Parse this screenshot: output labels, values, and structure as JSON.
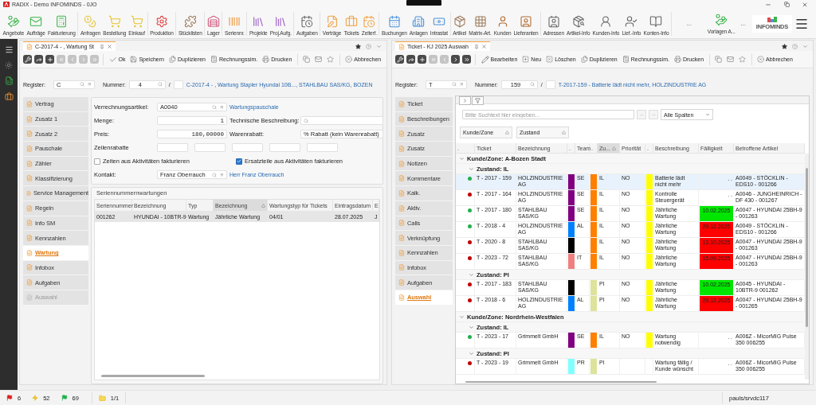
{
  "title_bar": {
    "title": "RADIX - Demo INFOMINDS - 0JO"
  },
  "ribbon": {
    "groups": [
      [
        "Angebote",
        "Aufträge",
        "Fakturierung"
      ],
      [
        "Anfragen",
        "Bestellung",
        "Einkauf"
      ],
      [
        "Produktion"
      ],
      [
        "Stücklisten"
      ],
      [
        "Lager"
      ],
      [
        "Seriennr."
      ],
      [
        "Projekte",
        "Proj.Aufg."
      ],
      [
        "Aufgaben"
      ],
      [
        "Verträge",
        "Tickets",
        "Zeiterf."
      ],
      [
        "Buchungen",
        "Anlagen",
        "Intrastat"
      ],
      [
        "Artikel",
        "Matrix-Art.",
        "Kunden",
        "Lieferanten"
      ],
      [
        "Adressen",
        "Artikel-Info",
        "Kunden-Info",
        "Lief.-Info",
        "Konten-Info"
      ]
    ],
    "more": "...",
    "templates": "Vorlagen A...",
    "more_right": "...",
    "logo_text": "INFOMINDS"
  },
  "panels": [
    {
      "kind": "contract",
      "tab": {
        "label": "C-2017-4 - , Wartung St"
      },
      "nav_buttons": [
        {
          "disabled": false
        },
        {
          "disabled": false
        },
        {
          "disabled": false
        },
        {
          "disabled": true
        },
        {
          "disabled": true
        },
        {
          "disabled": true
        },
        {
          "disabled": true
        }
      ],
      "actions": [
        {
          "kind": "ok",
          "label": "Ok"
        },
        {
          "kind": "save",
          "label": "Speichern"
        },
        {
          "kind": "duplicate",
          "label": "Duplizieren"
        },
        {
          "kind": "simulate",
          "label": "Rechnungssim."
        },
        {
          "kind": "print",
          "label": "Drucken"
        },
        {
          "kind": "copy"
        },
        {
          "kind": "mail"
        },
        {
          "kind": "favorite"
        },
        {
          "kind": "cancel",
          "label": "Abbrechen"
        }
      ],
      "register": {
        "label": "Register:",
        "value": "C",
        "number_label": "Nummer:",
        "number": "4",
        "separator": "/",
        "summary": "C-2017-4 - , Wartung Stapler Hyundai 10B..., STAHLBAU SAS/KG, BOZEN"
      },
      "nav": [
        {
          "label": "Vertrag",
          "selected": false,
          "disabled": false
        },
        {
          "label": "Zusatz 1",
          "selected": false,
          "disabled": false
        },
        {
          "label": "Zusatz 2",
          "selected": false,
          "disabled": false
        },
        {
          "label": "Pauschale",
          "selected": false,
          "disabled": false
        },
        {
          "label": "Zähler",
          "selected": false,
          "disabled": false
        },
        {
          "label": "Klassifizierung",
          "selected": false,
          "disabled": false
        },
        {
          "label": "Service Management",
          "selected": false,
          "disabled": false
        },
        {
          "label": "Regeln",
          "selected": false,
          "disabled": false
        },
        {
          "label": "Info SM",
          "selected": false,
          "disabled": false
        },
        {
          "label": "Kennzahlen",
          "selected": false,
          "disabled": false
        },
        {
          "label": "Wartung",
          "selected": true,
          "disabled": false
        },
        {
          "label": "Infobox",
          "selected": false,
          "disabled": false
        },
        {
          "label": "Aufgaben",
          "selected": false,
          "disabled": false
        },
        {
          "label": "Auswahl",
          "selected": false,
          "disabled": true
        }
      ],
      "form": {
        "article": {
          "label": "Verrechnungsartikel:",
          "value": "A0040",
          "link": "Wartungspauschale"
        },
        "quantity": {
          "label": "Menge:",
          "value": "1"
        },
        "tech_description": {
          "label": "Technische Beschreibung:"
        },
        "price": {
          "label": "Preis:",
          "value": "180,00000"
        },
        "discount": {
          "label": "Warenrabatt:",
          "value": "% Rabatt (kein Warenrabatt)"
        },
        "line_discounts": {
          "label": "Zeilenrabatte"
        },
        "checkboxes": [
          {
            "label": "Zeiten aus Aktivitäten fakturieren",
            "checked": false
          },
          {
            "label": "Ersatzteile aus Aktivitäten fakturieren",
            "checked": true
          }
        ],
        "contact": {
          "label": "Kontakt:",
          "value": "Franz Oberrauch",
          "link": "Herr Franz Oberrauch"
        }
      },
      "maintenance": {
        "title": "Seriennummernwartungen",
        "columns": [
          {
            "label": "Seriennummer",
            "sorted": false
          },
          {
            "label": "Bezeichnung",
            "sorted": false
          },
          {
            "label": "Typ",
            "sorted": false
          },
          {
            "label": "Bezeichnung",
            "sorted": true
          },
          {
            "label": "Wartungstyp für Tickets",
            "sorted": false
          },
          {
            "label": "Eintragsdatum",
            "sorted": false
          },
          {
            "label": "E",
            "sorted": false
          }
        ],
        "rows": [
          {
            "selected": true,
            "cells": [
              "001262",
              "HYUNDAI - 10BTR-9",
              "Wartung",
              "Jährliche Wartung",
              "04/01",
              "28.07.2025",
              "J"
            ]
          }
        ]
      }
    },
    {
      "kind": "tickets",
      "tab": {
        "label": "Ticket - KJ 2025 Auswah"
      },
      "nav_buttons": [
        {
          "disabled": false
        },
        {
          "disabled": false
        },
        {
          "disabled": false
        },
        {
          "disabled": true
        },
        {
          "disabled": true
        },
        {
          "disabled": false
        },
        {
          "disabled": false
        }
      ],
      "actions": [
        {
          "kind": "edit",
          "label": "Bearbeiten"
        },
        {
          "kind": "new",
          "label": "Neu"
        },
        {
          "kind": "delete",
          "label": "Löschen"
        },
        {
          "kind": "duplicate",
          "label": "Duplizieren"
        },
        {
          "kind": "simulate",
          "label": "Rechnungssim."
        },
        {
          "kind": "print",
          "label": "Drucken"
        },
        {
          "kind": "copy"
        },
        {
          "kind": "mail"
        },
        {
          "kind": "favorite"
        },
        {
          "kind": "cancel",
          "label": "Abbrechen"
        }
      ],
      "register": {
        "label": "Register:",
        "value": "T",
        "number_label": "Nummer:",
        "number": "159",
        "separator": "/",
        "summary": "T-2017-159 - Batterie lädt nicht mehr, HOLZINDUSTRIE AG"
      },
      "nav": [
        {
          "label": "Ticket",
          "selected": false,
          "disabled": false
        },
        {
          "label": "Beschreibungen",
          "selected": false,
          "disabled": false
        },
        {
          "label": "Zusatz",
          "selected": false,
          "disabled": false
        },
        {
          "label": "Zusatz",
          "selected": false,
          "disabled": false
        },
        {
          "label": "Notizen",
          "selected": false,
          "disabled": false
        },
        {
          "label": "Kommentare",
          "selected": false,
          "disabled": false
        },
        {
          "label": "Kalk.",
          "selected": false,
          "disabled": false
        },
        {
          "label": "Aktiv.",
          "selected": false,
          "disabled": false
        },
        {
          "label": "Calls",
          "selected": false,
          "disabled": false
        },
        {
          "label": "Verknüpfung",
          "selected": false,
          "disabled": false
        },
        {
          "label": "Kennzahlen",
          "selected": false,
          "disabled": false
        },
        {
          "label": "Infobox",
          "selected": false,
          "disabled": false
        },
        {
          "label": "Aufgaben",
          "selected": false,
          "disabled": false
        },
        {
          "label": "Auswahl",
          "selected": true,
          "disabled": false
        }
      ],
      "grid": {
        "search": {
          "placeholder": "Bitte Suchtext hier eingeben..."
        },
        "column_filter": "Alle Spalten",
        "group_by": [
          {
            "label": "Kunde/Zone"
          },
          {
            "label": "Zustand"
          }
        ],
        "columns": [
          {
            "label": ".",
            "sorted": false
          },
          {
            "label": "Ticket",
            "sorted": false
          },
          {
            "label": "Bezeichnung",
            "sorted": false
          },
          {
            "label": ".",
            "sorted": false
          },
          {
            "label": "Team",
            "sorted": false
          },
          {
            "label": ".",
            "sorted": false
          },
          {
            "label": "Zu...",
            "sorted": true
          },
          {
            "label": "Priorität",
            "sorted": false
          },
          {
            "label": ".",
            "sorted": false
          },
          {
            "label": "Beschreibung",
            "sorted": false
          },
          {
            "label": "Fälligkeit",
            "sorted": false
          },
          {
            "label": "Betroffene Artikel",
            "sorted": false
          }
        ],
        "groups": [
          {
            "label": "Kunde/Zone: A-Bozen Stadt",
            "expanded": true,
            "children": [
              {
                "label": "Zustand: IL",
                "expanded": true,
                "rows": [
                  {
                    "selected": true,
                    "color": "#22b14c",
                    "ticket": "T - 2017 - 159",
                    "name": "HOLZINDUSTRIE AG",
                    "team": {
                      "label": "SE",
                      "color": "#800080"
                    },
                    "state": {
                      "label": "IL",
                      "color": "#ff8000"
                    },
                    "priority": {
                      "label": "NO",
                      "color": "#ffff00"
                    },
                    "description": "Batterie lädt nicht mehr",
                    "due": {
                      "label": ". ."
                    },
                    "article": "A0049 - STÖCKLIN - EDS10 - 001266"
                  },
                  {
                    "selected": false,
                    "color": "#c00000",
                    "ticket": "T - 2017 - 164",
                    "name": "HOLZINDUSTRIE AG",
                    "team": {
                      "label": "SE",
                      "color": "#800080"
                    },
                    "state": {
                      "label": "IL",
                      "color": "#ff8000"
                    },
                    "priority": {
                      "label": "NO",
                      "color": "#ffff00"
                    },
                    "description": "Kontrolle Steuergerät",
                    "due": {
                      "label": ". ."
                    },
                    "article": "A0046 - JUNGHEINRICH - DF 430 - 001267"
                  },
                  {
                    "selected": false,
                    "color": "#22b14c",
                    "ticket": "T - 2017 - 180",
                    "name": "STAHLBAU SAS/KG",
                    "team": {
                      "label": "SE",
                      "color": "#800080"
                    },
                    "state": {
                      "label": "IL",
                      "color": "#ff8000"
                    },
                    "priority": {
                      "label": "NO",
                      "color": "#ffff00"
                    },
                    "description": "Jährliche Wartung",
                    "due": {
                      "label": "10.02.2025",
                      "color": "#00e600"
                    },
                    "article": "A0047 - HYUNDAI 25BH-9 - 001263"
                  },
                  {
                    "selected": false,
                    "color": "#22b14c",
                    "ticket": "T - 2018 - 4",
                    "name": "HOLZINDUSTRIE AG",
                    "team": {
                      "label": "AL",
                      "color": "#0080ff"
                    },
                    "state": {
                      "label": "IL",
                      "color": "#ff8000"
                    },
                    "priority": {
                      "label": "NO",
                      "color": "#ffff00"
                    },
                    "description": "Jährliche Wartung",
                    "due": {
                      "label": "29.12.2025",
                      "color": "#ff0000"
                    },
                    "article": "A0049 - STÖCKLIN - EDS10 - 001266"
                  },
                  {
                    "selected": false,
                    "color": "#c00000",
                    "ticket": "T - 2020 - 8",
                    "name": "STAHLBAU SAS/KG",
                    "team": {
                      "color": "#000000"
                    },
                    "state": {
                      "label": "IL",
                      "color": "#ff8000"
                    },
                    "priority": {
                      "label": "NO",
                      "color": "#ffff00"
                    },
                    "description": "Jährliche Wartung",
                    "due": {
                      "label": "13.10.2025",
                      "color": "#ff0000"
                    },
                    "article": "A0047 - HYUNDAI 25BH-9 - 001263"
                  },
                  {
                    "selected": false,
                    "color": "#c00000",
                    "ticket": "T - 2023 - 72",
                    "name": "STAHLBAU SAS/KG",
                    "team": {
                      "label": "IT",
                      "color": "#f08080"
                    },
                    "state": {
                      "label": "IL",
                      "color": "#ff8000"
                    },
                    "priority": {
                      "label": "NO",
                      "color": "#ffff00"
                    },
                    "description": "Jährliche Wartung",
                    "due": {
                      "label": "15.09.2025",
                      "color": "#ff0000"
                    },
                    "article": "A0047 - HYUNDAI 25BH-9 - 001263"
                  }
                ]
              },
              {
                "label": "Zustand: PI",
                "expanded": true,
                "rows": [
                  {
                    "selected": false,
                    "color": "#c00000",
                    "ticket": "T - 2017 - 183",
                    "name": "STAHLBAU SAS/KG",
                    "team": {
                      "color": "#000000"
                    },
                    "state": {
                      "label": "PI",
                      "color": "#dde39a"
                    },
                    "priority": {
                      "label": "NO",
                      "color": "#ffff00"
                    },
                    "description": "Jährliche Wartung",
                    "due": {
                      "label": "10.02.2025",
                      "color": "#00e600"
                    },
                    "article": "A0045 - HYUNDAI - 10BTR-9 001262"
                  },
                  {
                    "selected": false,
                    "color": "#c00000",
                    "ticket": "T - 2018 - 6",
                    "name": "HOLZINDUSTRIE AG",
                    "team": {
                      "label": "AL",
                      "color": "#0080ff"
                    },
                    "state": {
                      "label": "PI",
                      "color": "#dde39a"
                    },
                    "priority": {
                      "label": "NO",
                      "color": "#ffff00"
                    },
                    "description": "Jährliche Wartung",
                    "due": {
                      "label": "29.12.2025",
                      "color": "#ff0000"
                    },
                    "article": "A0047 - HYUNDAI 25BH-9 - 001265"
                  }
                ]
              }
            ]
          },
          {
            "label": "Kunde/Zone: Nordrhein-Westfalen",
            "expanded": true,
            "children": [
              {
                "label": "Zustand: IL",
                "expanded": true,
                "rows": [
                  {
                    "selected": false,
                    "color": "#22b14c",
                    "ticket": "T - 2023 - 17",
                    "name": "Grimmelt GmbH",
                    "team": {
                      "label": "SE",
                      "color": "#800080"
                    },
                    "state": {
                      "label": "IL",
                      "color": "#ff8000"
                    },
                    "priority": {
                      "label": "NO",
                      "color": "#ffff00"
                    },
                    "description": "Wartung notwendig",
                    "due": {
                      "label": ". ."
                    },
                    "article": "A006Z - MicorMIG Pulse 350 006255"
                  }
                ]
              },
              {
                "label": "Zustand: PI",
                "expanded": true,
                "rows": [
                  {
                    "selected": false,
                    "color": "#c00000",
                    "ticket": "T - 2023 - 19",
                    "name": "Grimmelt GmbH",
                    "team": {
                      "label": "PR",
                      "color": "#80ffff"
                    },
                    "state": {
                      "label": "PI",
                      "color": "#dde39a"
                    },
                    "description": "Wartung fällig / Kunde wünscht",
                    "due": {
                      "label": ". ."
                    },
                    "article": "A006Z - MicorMIG Pulse 350 006255"
                  }
                ]
              }
            ]
          }
        ]
      }
    }
  ],
  "status_bar": {
    "items": [
      {
        "kind": "error",
        "count": "6"
      },
      {
        "kind": "warning",
        "count": "52"
      },
      {
        "kind": "ok",
        "count": "69"
      }
    ],
    "pages": "1/1",
    "user": "pauls/srvdc117"
  }
}
